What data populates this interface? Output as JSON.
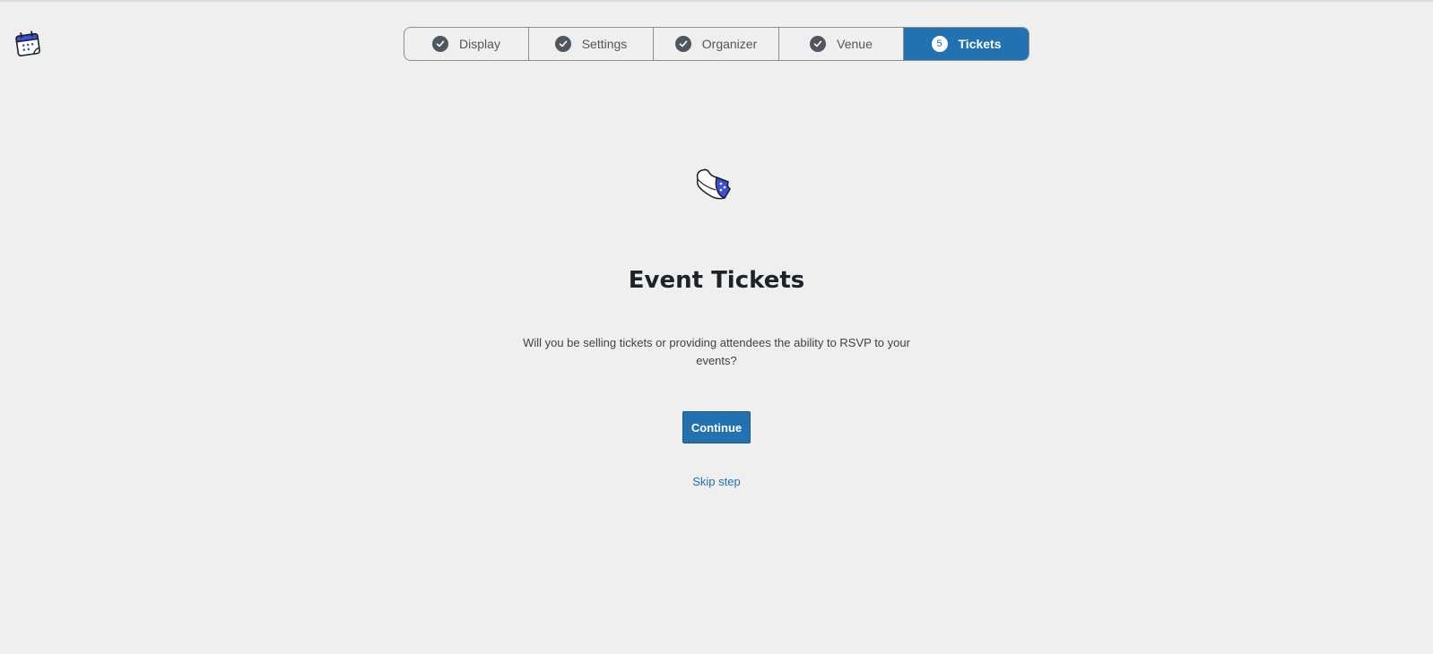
{
  "steps": [
    {
      "label": "Display",
      "state": "complete",
      "icon": "check-icon"
    },
    {
      "label": "Settings",
      "state": "complete",
      "icon": "check-icon"
    },
    {
      "label": "Organizer",
      "state": "complete",
      "icon": "check-icon"
    },
    {
      "label": "Venue",
      "state": "complete",
      "icon": "check-icon"
    },
    {
      "label": "Tickets",
      "state": "active",
      "number": "5"
    }
  ],
  "main": {
    "title": "Event Tickets",
    "description": "Will you be selling tickets or providing attendees the ability to RSVP to your events?",
    "continue_label": "Continue",
    "skip_label": "Skip step"
  },
  "icons": {
    "logo": "calendar-logo-icon",
    "illustration": "ticket-icon"
  },
  "colors": {
    "accent": "#2271b1",
    "background": "#efefef",
    "illustration_blue": "#3c4fe0"
  }
}
